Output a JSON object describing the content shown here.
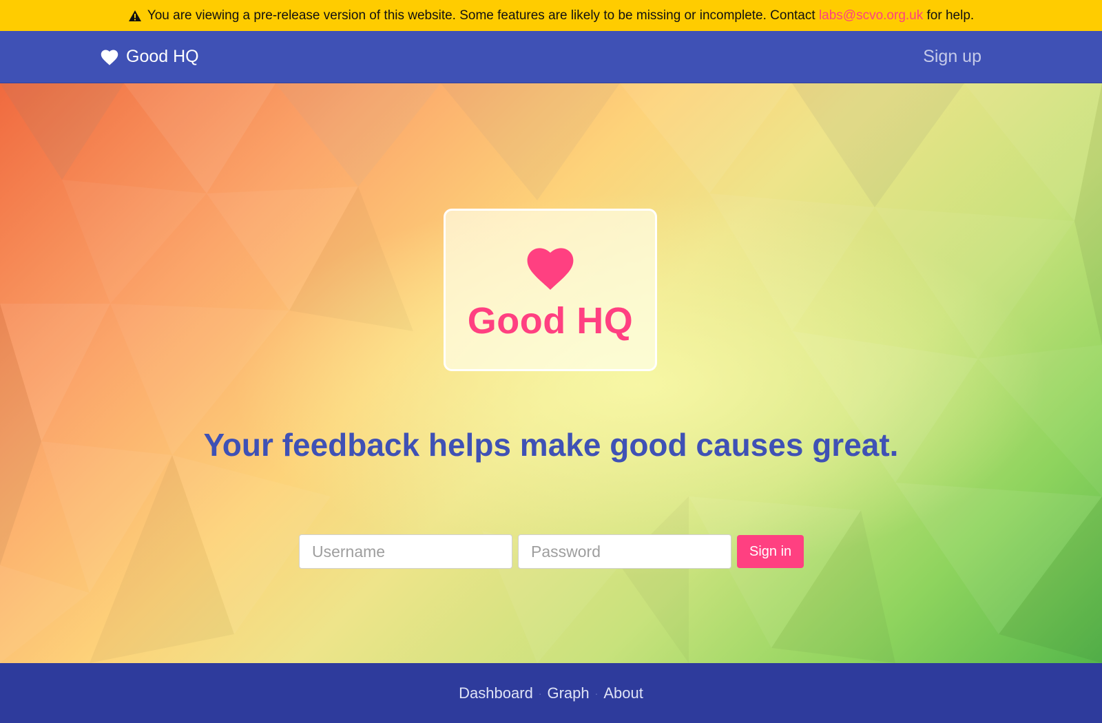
{
  "banner": {
    "icon": "warning-icon",
    "text_before": "You are viewing a pre-release version of this website. Some features are likely to be missing or incomplete. Contact ",
    "email": "labs@scvo.org.uk",
    "text_after": " for help.",
    "bg_color": "#ffcc00",
    "link_color": "#ff4081"
  },
  "navbar": {
    "brand": "Good HQ",
    "brand_icon": "heart-icon",
    "signup_label": "Sign up",
    "bg_color": "#3f51b5"
  },
  "hero": {
    "logo_title": "Good HQ",
    "logo_icon": "heart-icon",
    "tagline": "Your feedback helps make good causes great.",
    "accent_color": "#ff4081",
    "tagline_color": "#3f51b5"
  },
  "signin": {
    "username_placeholder": "Username",
    "password_placeholder": "Password",
    "submit_label": "Sign in"
  },
  "footer": {
    "links": [
      "Dashboard",
      "Graph",
      "About"
    ],
    "separator": "·",
    "bg_color": "#2e3b9c"
  }
}
